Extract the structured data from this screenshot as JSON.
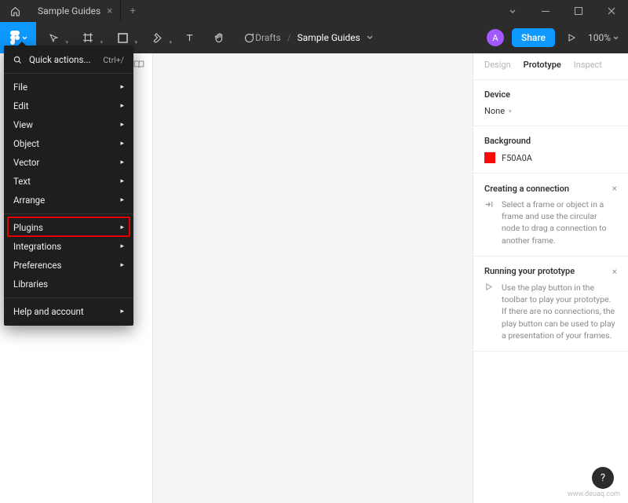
{
  "titlebar": {
    "tab_name": "Sample Guides"
  },
  "toolbar": {
    "breadcrumb_root": "Drafts",
    "breadcrumb_name": "Sample Guides",
    "avatar_initial": "A",
    "share_label": "Share",
    "zoom": "100%"
  },
  "menu": {
    "quick_actions": "Quick actions...",
    "quick_shortcut": "Ctrl+/",
    "items1": [
      "File",
      "Edit",
      "View",
      "Object",
      "Vector",
      "Text",
      "Arrange"
    ],
    "items2": [
      "Plugins",
      "Integrations",
      "Preferences",
      "Libraries"
    ],
    "items3": [
      "Help and account"
    ],
    "highlight_index": 0
  },
  "right_panel": {
    "tabs": {
      "design": "Design",
      "prototype": "Prototype",
      "inspect": "Inspect"
    },
    "device": {
      "title": "Device",
      "value": "None"
    },
    "background": {
      "title": "Background",
      "color_label": "F50A0A",
      "color_hex": "#f50a0a"
    },
    "help1": {
      "title": "Creating a connection",
      "body": "Select a frame or object in a frame and use the circular node to drag a connection to another frame."
    },
    "help2": {
      "title": "Running your prototype",
      "body": "Use the play button in the toolbar to play your prototype. If there are no connections, the play button can be used to play a presentation of your frames."
    }
  },
  "watermark": "www.deuaq.com"
}
